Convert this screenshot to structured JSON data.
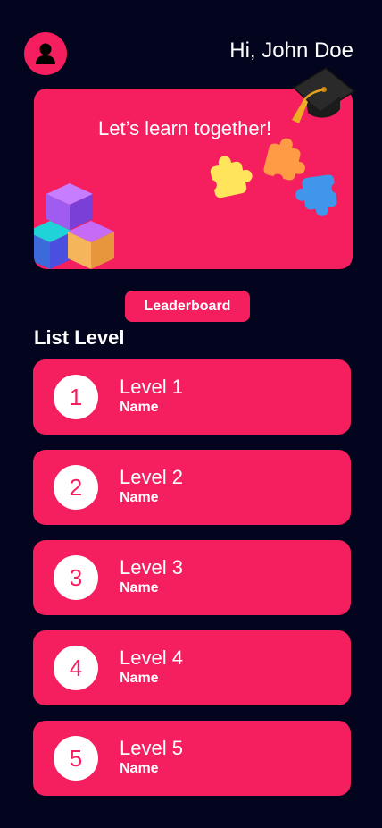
{
  "header": {
    "greeting": "Hi, John Doe",
    "avatar_icon": "user-icon",
    "cap_icon": "graduation-cap-icon"
  },
  "hero": {
    "text": "Let’s learn together!",
    "illustrations": [
      "isometric-cubes-icon",
      "puzzle-pieces-icon"
    ]
  },
  "leaderboard_label": "Leaderboard",
  "list_title": "List Level",
  "levels": [
    {
      "num": "1",
      "title": "Level 1",
      "subtitle": "Name"
    },
    {
      "num": "2",
      "title": "Level 2",
      "subtitle": "Name"
    },
    {
      "num": "3",
      "title": "Level 3",
      "subtitle": "Name"
    },
    {
      "num": "4",
      "title": "Level 4",
      "subtitle": "Name"
    },
    {
      "num": "5",
      "title": "Level 5",
      "subtitle": "Name"
    }
  ],
  "colors": {
    "background": "#03051f",
    "accent": "#f51e5e",
    "text": "#ffffff"
  }
}
